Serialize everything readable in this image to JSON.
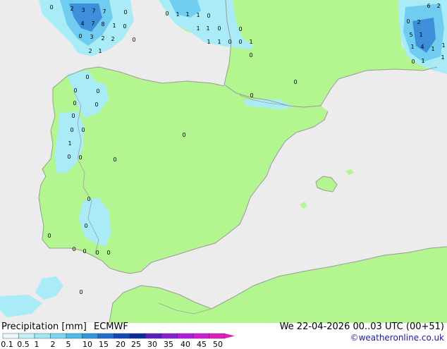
{
  "header": {
    "title": "Precipitation [mm]",
    "model": "ECMWF",
    "datetime": "We 22-04-2026 00..03 UTC (00+51)",
    "credit": "©weatheronline.co.uk"
  },
  "colors": {
    "sea": "#ececec",
    "land": "#b3f58f",
    "coast": "#9a9a9a",
    "border": "#a0a0a0",
    "rain_light": "#a9ecf7",
    "rain_medium": "#70cdf0",
    "rain_heavy": "#3d8fdc"
  },
  "legend": {
    "labels": [
      "0.1",
      "0.5",
      "1",
      "2",
      "5",
      "10",
      "15",
      "20",
      "25",
      "30",
      "35",
      "40",
      "45",
      "50"
    ],
    "colors": [
      "#eaf8fb",
      "#c6f0f7",
      "#a2e6f5",
      "#7ad6f2",
      "#4fbde8",
      "#2e97de",
      "#1e6fd0",
      "#1346b8",
      "#0a2b9c",
      "#5a1fc0",
      "#8c1fd8",
      "#b21ee0",
      "#d01ed6",
      "#e01ec0"
    ]
  },
  "map_values": [
    {
      "v": "0"
    },
    {
      "v": "2"
    },
    {
      "v": "3"
    },
    {
      "v": "7"
    },
    {
      "v": "7"
    },
    {
      "v": "0"
    },
    {
      "v": "4"
    },
    {
      "v": "7"
    },
    {
      "v": "8"
    },
    {
      "v": "1"
    },
    {
      "v": "0"
    },
    {
      "v": "0"
    },
    {
      "v": "3"
    },
    {
      "v": "2"
    },
    {
      "v": "2"
    },
    {
      "v": "0"
    },
    {
      "v": "2"
    },
    {
      "v": "1"
    },
    {
      "v": "0"
    },
    {
      "v": "1"
    },
    {
      "v": "1"
    },
    {
      "v": "1"
    },
    {
      "v": "0"
    },
    {
      "v": "1"
    },
    {
      "v": "1"
    },
    {
      "v": "0"
    },
    {
      "v": "0"
    },
    {
      "v": "1"
    },
    {
      "v": "1"
    },
    {
      "v": "0"
    },
    {
      "v": "0"
    },
    {
      "v": "1"
    },
    {
      "v": "0"
    },
    {
      "v": "0"
    },
    {
      "v": "0"
    },
    {
      "v": "0"
    },
    {
      "v": "0"
    },
    {
      "v": "0"
    },
    {
      "v": "0"
    },
    {
      "v": "0"
    },
    {
      "v": "0"
    },
    {
      "v": "0"
    },
    {
      "v": "1"
    },
    {
      "v": "0"
    },
    {
      "v": "0"
    },
    {
      "v": "0"
    },
    {
      "v": "0"
    },
    {
      "v": "0"
    },
    {
      "v": "0"
    },
    {
      "v": "0"
    },
    {
      "v": "0"
    },
    {
      "v": "0"
    },
    {
      "v": "0"
    },
    {
      "v": "0"
    },
    {
      "v": "0"
    },
    {
      "v": "0"
    },
    {
      "v": "6"
    },
    {
      "v": "2"
    },
    {
      "v": "0"
    },
    {
      "v": "2"
    },
    {
      "v": "5"
    },
    {
      "v": "1"
    },
    {
      "v": "1"
    },
    {
      "v": "4"
    },
    {
      "v": "1"
    },
    {
      "v": "1"
    },
    {
      "v": "0"
    },
    {
      "v": "1"
    },
    {
      "v": "1"
    }
  ]
}
